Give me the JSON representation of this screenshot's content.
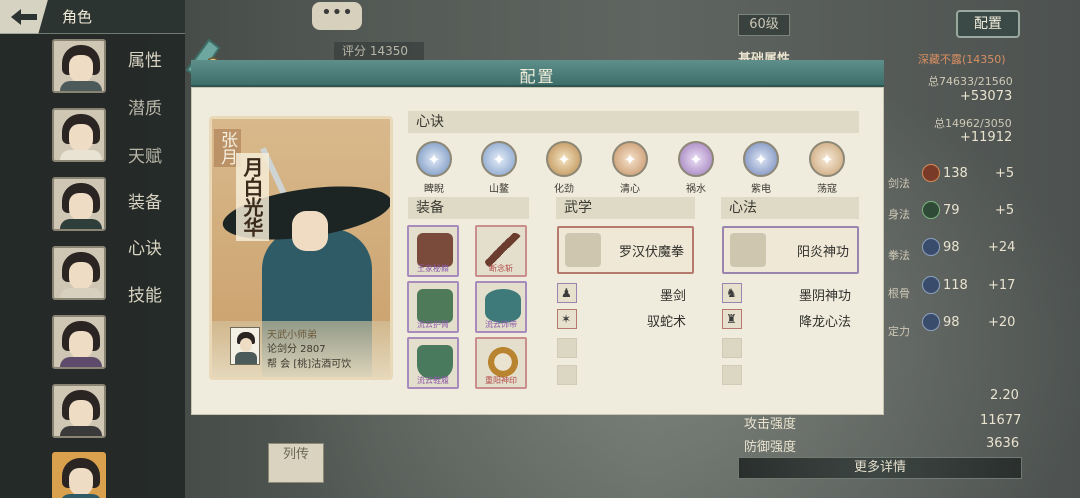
{
  "topbar": {
    "title": "角色"
  },
  "sidebar": {
    "tabs": [
      "属性",
      "潜质",
      "天赋",
      "装备",
      "心诀",
      "技能"
    ]
  },
  "background": {
    "chat_icon": "•••",
    "score_label": "评分 14350",
    "level": "60级",
    "config_button": "配置",
    "liezhuan": "列传",
    "base_attr_label": "基础属性",
    "realm": "深藏不露(14350)",
    "total1": "总74633/21560",
    "bonus1": "+53073",
    "total2": "总14962/3050",
    "bonus2": "+11912",
    "stats": [
      {
        "label": "剑法",
        "value": "138",
        "bonus": "+5"
      },
      {
        "label": "身法",
        "value": "79",
        "bonus": "+5"
      },
      {
        "label": "拳法",
        "value": "98",
        "bonus": "+24"
      },
      {
        "label": "根骨",
        "value": "118",
        "bonus": "+17"
      },
      {
        "label": "定力",
        "value": "98",
        "bonus": "+20"
      }
    ],
    "stat_value_crit": "2.20",
    "attack_label": "攻击强度",
    "attack_value": "11677",
    "defense_label": "防御强度",
    "defense_value": "3636",
    "more_details": "更多详情"
  },
  "modal": {
    "title": "配置",
    "character": {
      "title_vertical": "张月",
      "name_vertical": "月白光华",
      "rank": "天武小师弟",
      "score": "论剑分 2807",
      "guild": "帮  会 [桃]沽酒可饮"
    },
    "xinjue": {
      "header": "心诀",
      "items": [
        {
          "label": "睥睨",
          "color": "#6f8fbd"
        },
        {
          "label": "山鳌",
          "color": "#7d9cc7"
        },
        {
          "label": "化劲",
          "color": "#b98a4e"
        },
        {
          "label": "清心",
          "color": "#c49063"
        },
        {
          "label": "祸水",
          "color": "#9a78b8"
        },
        {
          "label": "紫电",
          "color": "#6f86b8"
        },
        {
          "label": "荡寇",
          "color": "#c7a173"
        }
      ]
    },
    "equipment": {
      "header": "装备",
      "items": [
        {
          "label": "王家秘籍",
          "rarity": "purple",
          "art_color": "#7a4a3a"
        },
        {
          "label": "断念斩",
          "rarity": "red",
          "art_color": "#6a3d2e"
        },
        {
          "label": "流云护臂",
          "rarity": "purple",
          "art_color": "#4e7a5a"
        },
        {
          "label": "流云饰带",
          "rarity": "purple",
          "art_color": "#3f7a7a"
        },
        {
          "label": "流云鞋履",
          "rarity": "purple",
          "art_color": "#4a7a5e"
        },
        {
          "label": "重阳神印",
          "rarity": "red",
          "art_color": "#b9842f"
        }
      ]
    },
    "wuxue": {
      "header": "武学",
      "main": "罗汉伏魔拳",
      "rows": [
        {
          "name": "墨剑",
          "glyph": "♟",
          "rarity": "purple"
        },
        {
          "name": "驭蛇术",
          "glyph": "✶",
          "rarity": "red"
        },
        {
          "name": "",
          "glyph": "",
          "rarity": "empty"
        },
        {
          "name": "",
          "glyph": "",
          "rarity": "empty"
        }
      ]
    },
    "xinfa": {
      "header": "心法",
      "main": "阳炎神功",
      "rows": [
        {
          "name": "墨阴神功",
          "glyph": "♞",
          "rarity": "purple"
        },
        {
          "name": "降龙心法",
          "glyph": "♜",
          "rarity": "red"
        },
        {
          "name": "",
          "glyph": "",
          "rarity": "empty"
        },
        {
          "name": "",
          "glyph": "",
          "rarity": "empty"
        }
      ]
    }
  }
}
